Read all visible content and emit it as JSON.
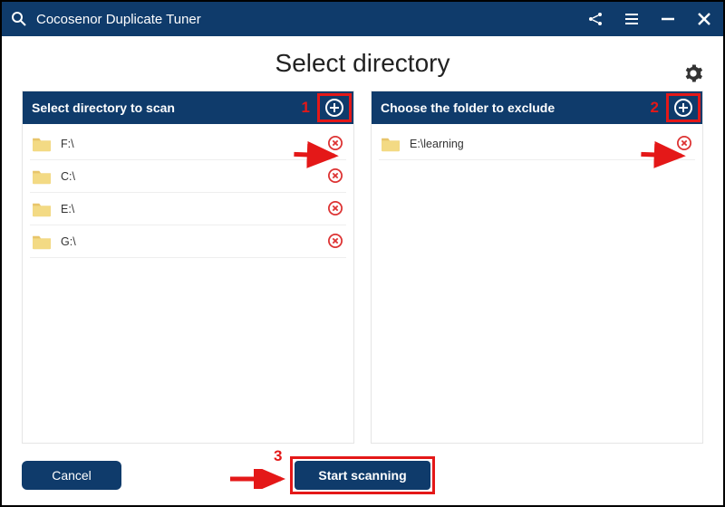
{
  "app": {
    "title": "Cocosenor Duplicate Tuner"
  },
  "heading": "Select directory",
  "panels": {
    "scan": {
      "title": "Select directory to scan",
      "marker": "1",
      "items": [
        {
          "path": "F:\\"
        },
        {
          "path": "C:\\"
        },
        {
          "path": "E:\\"
        },
        {
          "path": "G:\\"
        }
      ]
    },
    "exclude": {
      "title": "Choose the folder to exclude",
      "marker": "2",
      "items": [
        {
          "path": "E:\\learning"
        }
      ]
    }
  },
  "footer": {
    "cancel": "Cancel",
    "start": "Start scanning",
    "marker": "3"
  },
  "colors": {
    "brand": "#0f3b6b",
    "accent": "#e41818"
  }
}
